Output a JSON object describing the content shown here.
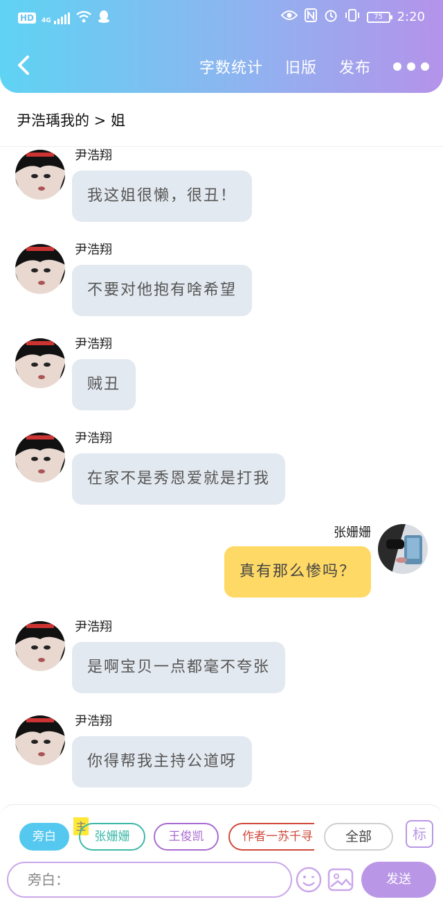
{
  "status_bar": {
    "network": "HD",
    "signal": "4G",
    "battery": "75",
    "time": "2:20"
  },
  "header": {
    "word_count": "字数统计",
    "old_version": "旧版",
    "publish": "发布"
  },
  "story_title": "尹浩瑀我的 > 姐",
  "messages": [
    {
      "side": "left",
      "name": "尹浩翔",
      "text": "我这姐很懒，很丑！"
    },
    {
      "side": "left",
      "name": "尹浩翔",
      "text": "不要对他抱有啥希望"
    },
    {
      "side": "left",
      "name": "尹浩翔",
      "text": "贼丑"
    },
    {
      "side": "left",
      "name": "尹浩翔",
      "text": "在家不是秀恩爱就是打我"
    },
    {
      "side": "right",
      "name": "张姗姗",
      "text": "真有那么惨吗？"
    },
    {
      "side": "left",
      "name": "尹浩翔",
      "text": "是啊宝贝一点都毫不夸张"
    },
    {
      "side": "left",
      "name": "尹浩翔",
      "text": "你得帮我主持公道呀"
    }
  ],
  "roles": {
    "narrator": "旁白",
    "main_tag": "主",
    "zhang": "张姗姗",
    "wang": "王俊凯",
    "author": "作者一苏千寻",
    "all": "全部",
    "mark": "标"
  },
  "composer": {
    "placeholder": "旁白：",
    "send": "发送"
  },
  "colors": {
    "gradient_start": "#5fd3f3",
    "gradient_end": "#b493ea",
    "left_bubble": "#e3e9f0",
    "right_bubble": "#ffd966",
    "accent_purple": "#b996e6"
  }
}
